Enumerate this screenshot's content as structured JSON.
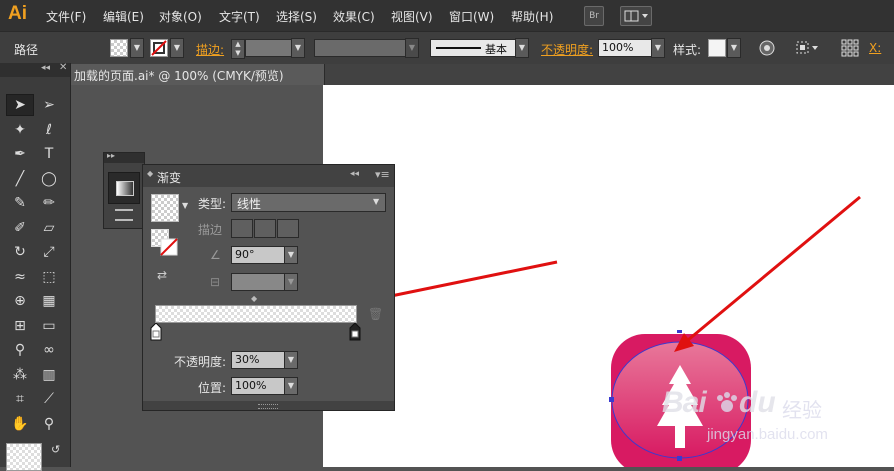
{
  "app": {
    "logo": "Ai"
  },
  "menubar": {
    "items": [
      "文件(F)",
      "编辑(E)",
      "对象(O)",
      "文字(T)",
      "选择(S)",
      "效果(C)",
      "视图(V)",
      "窗口(W)",
      "帮助(H)"
    ],
    "bridge_label": "Br"
  },
  "controlbar": {
    "selection_label": "路径",
    "stroke_label": "描边:",
    "stroke_profile": "基本",
    "opacity_label": "不透明度:",
    "opacity_value": "100%",
    "style_label": "样式:",
    "x_label": "X:"
  },
  "document": {
    "tab_title": "加载的页面.ai* @ 100% (CMYK/预览)"
  },
  "gradient_panel": {
    "title": "渐变",
    "type_label": "类型:",
    "type_value": "线性",
    "stroke_label": "描边",
    "angle_value": "90°",
    "opacity_label": "不透明度:",
    "opacity_value": "30%",
    "location_label": "位置:",
    "location_value": "100%"
  },
  "watermark": {
    "brand": "Bai",
    "brand_suffix": "du",
    "cn": "经验",
    "url": "jingyan.baidu.com"
  },
  "colors": {
    "accent": "#f0a020",
    "annotation_arrow": "#e01010",
    "icon_top": "#e8789a",
    "icon_bottom": "#d81a62",
    "selection": "#3a3ad0"
  }
}
